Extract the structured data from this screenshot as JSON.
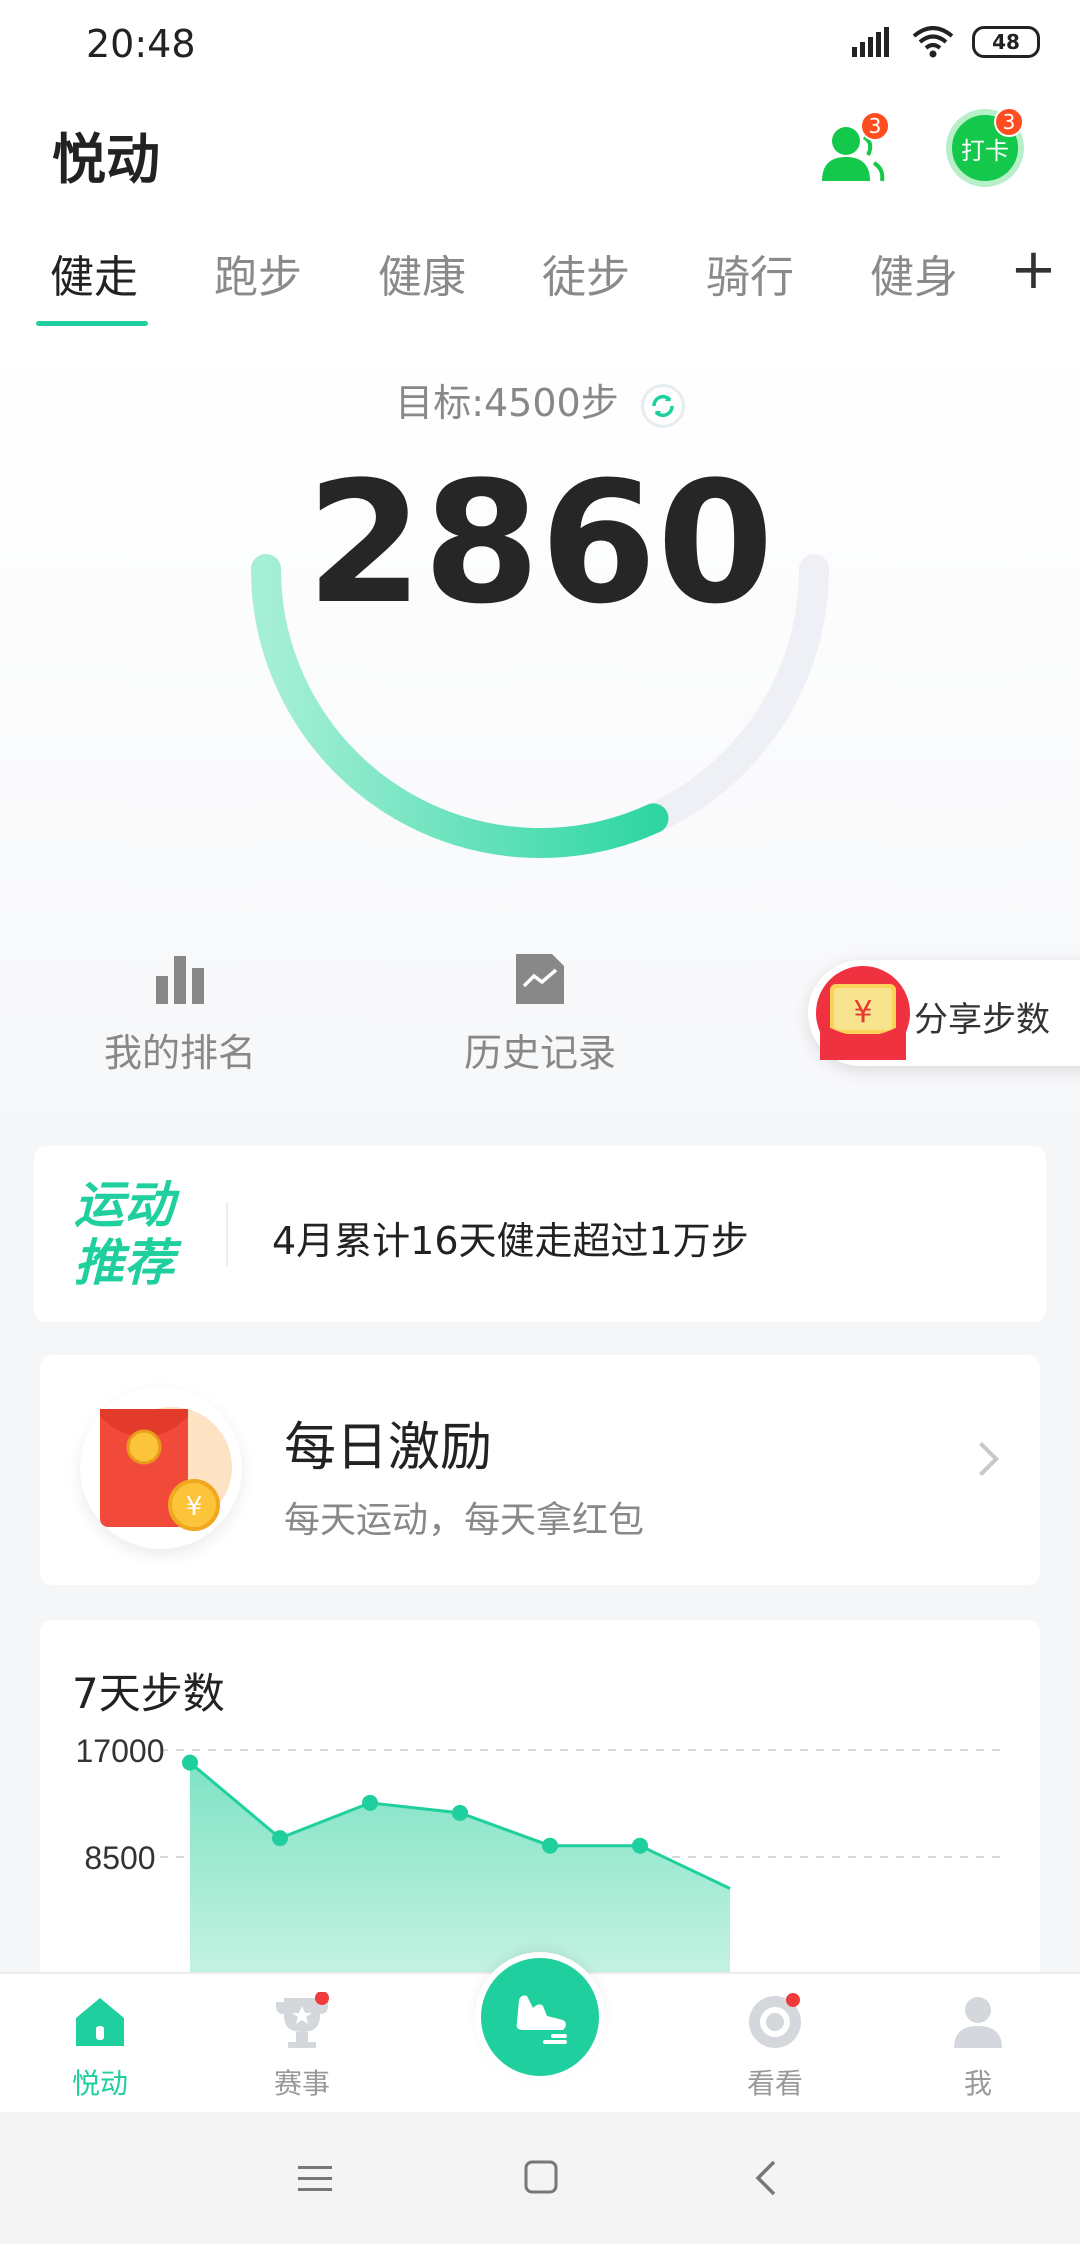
{
  "status_bar": {
    "time": "20:48",
    "battery": "48"
  },
  "header": {
    "title": "悦动",
    "friends_badge": "3",
    "checkin_label": "打卡",
    "checkin_badge": "3"
  },
  "tabs": [
    {
      "label": "健走",
      "active": true
    },
    {
      "label": "跑步"
    },
    {
      "label": "健康"
    },
    {
      "label": "徒步"
    },
    {
      "label": "骑行"
    },
    {
      "label": "健身"
    }
  ],
  "tab_add": "+",
  "hero": {
    "goal": "目标:4500步",
    "steps": "2860",
    "progress_fraction": 0.636
  },
  "quick_actions": {
    "ranking": "我的排名",
    "history": "历史记录",
    "share": "分享步数"
  },
  "recommend": {
    "tag_line1": "运动",
    "tag_line2": "推荐",
    "text": "4月累计16天健走超过1万步"
  },
  "daily": {
    "title": "每日激励",
    "subtitle": "每天运动，每天拿红包"
  },
  "chart_data": {
    "type": "area",
    "title": "7天步数",
    "y_ticks": [
      "17000",
      "8500"
    ],
    "ylim": [
      0,
      17000
    ],
    "values": [
      16000,
      10000,
      12800,
      12000,
      9400,
      9400,
      6000
    ],
    "color": "#1fcf9d"
  },
  "bottom_nav": [
    {
      "label": "悦动",
      "icon": "home-icon",
      "active": true
    },
    {
      "label": "赛事",
      "icon": "trophy-icon",
      "dot": true
    },
    {
      "label": "",
      "icon": "shoe-icon",
      "center": true
    },
    {
      "label": "看看",
      "icon": "discover-icon",
      "dot": true
    },
    {
      "label": "我",
      "icon": "profile-icon"
    }
  ],
  "colors": {
    "accent": "#1fcf9d",
    "badge": "#ff4d1f",
    "checkin": "#13c84a"
  }
}
